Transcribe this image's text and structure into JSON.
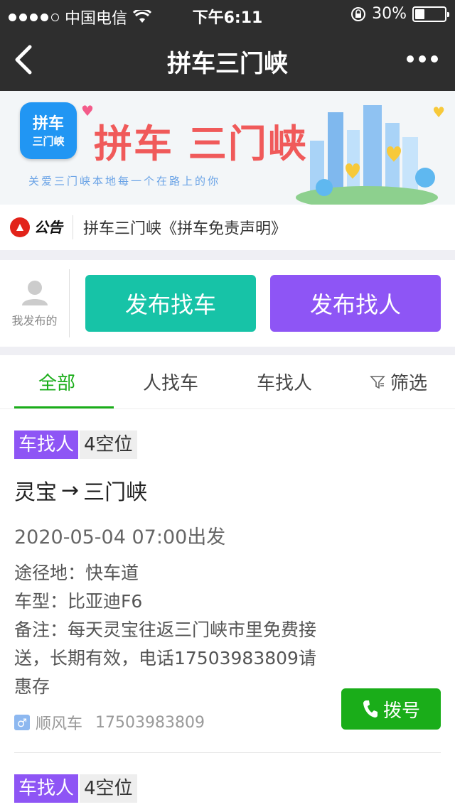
{
  "status_bar": {
    "carrier": "中国电信",
    "time": "下午6:11",
    "battery": "30%",
    "battery_level": 0.3
  },
  "nav": {
    "title": "拼车三门峡"
  },
  "banner": {
    "logo_line1": "拼车",
    "logo_line2": "三门峡",
    "title": "拼车 三门峡",
    "subtitle": "关爱三门峡本地每一个在路上的你"
  },
  "notice": {
    "tag": "公告",
    "text": "拼车三门峡《拼车免责声明》"
  },
  "publish": {
    "mine_label": "我发布的",
    "find_car_label": "发布找车",
    "find_person_label": "发布找人"
  },
  "tabs": [
    {
      "label": "全部"
    },
    {
      "label": "人找车"
    },
    {
      "label": "车找人"
    },
    {
      "label": "筛选"
    }
  ],
  "listings": [
    {
      "type": "车找人",
      "seats": "4空位",
      "from": "灵宝",
      "arrow": "→",
      "to": "三门峡",
      "depart": "2020-05-04 07:00出发",
      "via_label": "途径地：",
      "via": "快车道",
      "car_label": "车型：",
      "car": "比亚迪F6",
      "note_label": "备注：",
      "note": "每天灵宝往返三门峡市里免费接送，长期有效，电话17503983809请惠存",
      "gender_symbol": "♂",
      "category": "顺风车",
      "phone": "17503983809",
      "dial_label": "拨号"
    },
    {
      "type": "车找人",
      "seats": "4空位"
    }
  ],
  "colors": {
    "bar": "#2e2e2e",
    "green": "#1aad19",
    "teal": "#17c3a7",
    "purple": "#8e55f5"
  }
}
